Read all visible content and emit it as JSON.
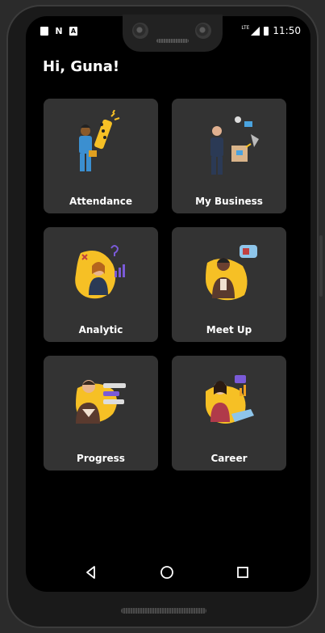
{
  "status_bar": {
    "left_icons": [
      "sd-card-icon",
      "n-notification-icon",
      "a-notification-icon"
    ],
    "network": "LTE",
    "time": "11:50"
  },
  "greeting": "Hi, Guna!",
  "tiles": [
    {
      "label": "Attendance",
      "icon": "attendance-illustration"
    },
    {
      "label": "My Business",
      "icon": "my-business-illustration"
    },
    {
      "label": "Analytic",
      "icon": "analytic-illustration"
    },
    {
      "label": "Meet Up",
      "icon": "meet-up-illustration"
    },
    {
      "label": "Progress",
      "icon": "progress-illustration"
    },
    {
      "label": "Career",
      "icon": "career-illustration"
    }
  ],
  "nav": [
    "back-icon",
    "home-icon",
    "recents-icon"
  ],
  "colors": {
    "background": "#000000",
    "card": "#333333",
    "accent_yellow": "#f6c025",
    "text": "#ffffff"
  }
}
